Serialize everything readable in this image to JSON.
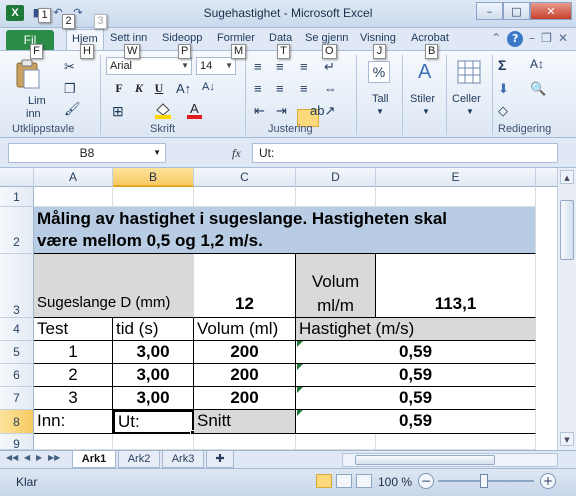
{
  "window": {
    "title": "Sugehastighet  -  Microsoft Excel",
    "buttons": {
      "minimize": "–",
      "maximize": "□",
      "close": "✕"
    }
  },
  "keytips": [
    "1",
    "2",
    "3",
    "F",
    "H",
    "W",
    "P",
    "M",
    "T",
    "O",
    "J",
    "B"
  ],
  "ribbon": {
    "file_tab": "Fil",
    "tabs": [
      "Hjem",
      "Sett inn",
      "Sideopp",
      "Formler",
      "Data",
      "Se gjenn",
      "Visning",
      "Acrobat"
    ],
    "groups": {
      "clipboard": "Utklippstavle",
      "font": "Skrift",
      "alignment": "Justering",
      "number": "Tall",
      "styles": "Stiler",
      "cells": "Celler",
      "editing": "Redigering"
    },
    "paste_label_1": "Lim",
    "paste_label_2": "inn",
    "font_name": "Arial",
    "font_size": "14",
    "bold": "F",
    "italic": "K",
    "underline": "U",
    "number_label": "Tall",
    "styles_label": "Stiler",
    "cells_label": "Celler",
    "percent": "%",
    "sigma": "Σ"
  },
  "formula_bar": {
    "name_box": "B8",
    "fx": "fx",
    "content": "Ut:"
  },
  "grid": {
    "columns": [
      "A",
      "B",
      "C",
      "D",
      "E"
    ],
    "selected_column": "B",
    "rows": [
      "1",
      "2",
      "3",
      "4",
      "5",
      "6",
      "7",
      "8",
      "9"
    ],
    "selected_row": "8",
    "cells": {
      "A2_line1": "Måling av hastighet i sugeslange. Hastigheten skal",
      "A2_line2": "være mellom 0,5 og 1,2 m/s.",
      "A3": "Sugeslange D (mm)",
      "C3": "12",
      "D3_line1": "Volum",
      "D3_line2": "ml/m",
      "E3": "113,1",
      "A4": "Test",
      "B4": "tid (s)",
      "C4": "Volum (ml)",
      "D4": "Hastighet (m/s)",
      "A5": "1",
      "B5": "3,00",
      "C5": "200",
      "E5": "0,59",
      "A6": "2",
      "B6": "3,00",
      "C6": "200",
      "E6": "0,59",
      "A7": "3",
      "B7": "3,00",
      "C7": "200",
      "E7": "0,59",
      "A8": "Inn:",
      "B8": "Ut:",
      "C8": "Snitt",
      "E8": "0,59"
    }
  },
  "sheets": {
    "tabs": [
      "Ark1",
      "Ark2",
      "Ark3"
    ],
    "active": "Ark1"
  },
  "statusbar": {
    "status": "Klar",
    "zoom": "100 %",
    "zoom_minus": "−",
    "zoom_plus": "+"
  }
}
